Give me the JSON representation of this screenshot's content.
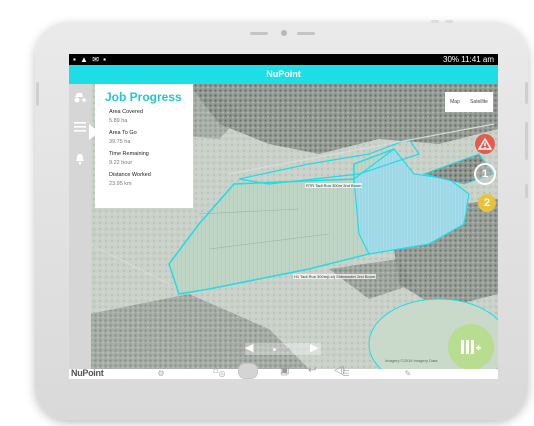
{
  "status_bar": {
    "right_text": "30% 11:41 am"
  },
  "app_bar": {
    "title": "NuPoint"
  },
  "job_progress": {
    "title": "Job Progress",
    "items": [
      {
        "label": "Area Covered",
        "value": "5.89 ha"
      },
      {
        "label": "Area To Go",
        "value": "39.75 ha"
      },
      {
        "label": "Time Remaining",
        "value": "9.22 hour"
      },
      {
        "label": "Distance Worked",
        "value": "23.95 km"
      }
    ]
  },
  "map_style": {
    "left": "Map",
    "right": "Satellite"
  },
  "map_labels": [
    "RTR Tadi Run 300m 2nd Boom",
    "H1 Tadi Run 300m(Lid) Sidewinder 2nd Boom"
  ],
  "badges": [
    {
      "text": "1",
      "color": "#ffffff"
    },
    {
      "text": "2",
      "color": "#e8c23a"
    }
  ],
  "hazard": {
    "text": "!",
    "color": "#e35d4f"
  },
  "attribution": "Imagery ©2019 Imagery Data",
  "logo": {
    "nu": "Nu",
    "point": "Point"
  },
  "colors": {
    "accent": "#1fdde5",
    "fab": "#b8dd90"
  }
}
